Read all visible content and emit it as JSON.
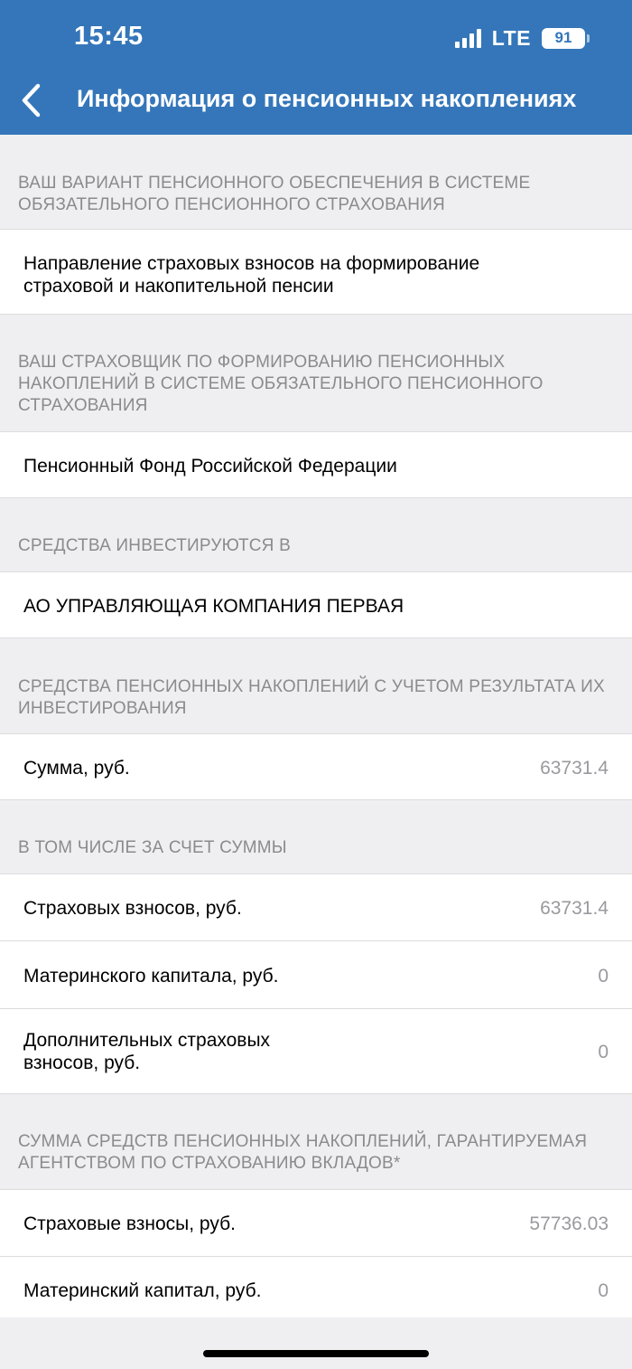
{
  "status_bar": {
    "time": "15:45",
    "network": "LTE",
    "battery": "91"
  },
  "nav": {
    "title": "Информация о пенсионных накоплениях"
  },
  "sections": [
    {
      "header": "ВАШ ВАРИАНТ ПЕНСИОННОГО ОБЕСПЕЧЕНИЯ В СИСТЕМЕ ОБЯЗАТЕЛЬНОГО ПЕНСИОННОГО СТРАХОВАНИЯ",
      "rows": [
        {
          "label": "Направление страховых взносов на формирование страховой и накопительной пенсии"
        }
      ]
    },
    {
      "header": "ВАШ СТРАХОВЩИК ПО ФОРМИРОВАНИЮ ПЕНСИОННЫХ НАКОПЛЕНИЙ В СИСТЕМЕ ОБЯЗАТЕЛЬНОГО ПЕНСИОННОГО СТРАХОВАНИЯ",
      "rows": [
        {
          "label": "Пенсионный Фонд Российской Федерации"
        }
      ]
    },
    {
      "header": "СРЕДСТВА ИНВЕСТИРУЮТСЯ В",
      "rows": [
        {
          "label": "АО УПРАВЛЯЮЩАЯ КОМПАНИЯ ПЕРВАЯ"
        }
      ]
    },
    {
      "header": "СРЕДСТВА ПЕНСИОННЫХ НАКОПЛЕНИЙ С УЧЕТОМ РЕЗУЛЬТАТА ИХ ИНВЕСТИРОВАНИЯ",
      "rows": [
        {
          "label": "Сумма, руб.",
          "value": "63731.4"
        }
      ]
    },
    {
      "header": "В ТОМ ЧИСЛЕ ЗА СЧЕТ СУММЫ",
      "rows": [
        {
          "label": "Страховых взносов, руб.",
          "value": "63731.4"
        },
        {
          "label": "Материнского капитала, руб.",
          "value": "0"
        },
        {
          "label": "Дополнительных страховых взносов, руб.",
          "value": "0"
        }
      ]
    },
    {
      "header": "СУММА СРЕДСТВ ПЕНСИОННЫХ НАКОПЛЕНИЙ, ГАРАНТИРУЕМАЯ АГЕНТСТВОМ ПО СТРАХОВАНИЮ ВКЛАДОВ*",
      "rows": [
        {
          "label": "Страховые взносы, руб.",
          "value": "57736.03"
        },
        {
          "label": "Материнский капитал, руб.",
          "value": "0"
        }
      ]
    }
  ]
}
